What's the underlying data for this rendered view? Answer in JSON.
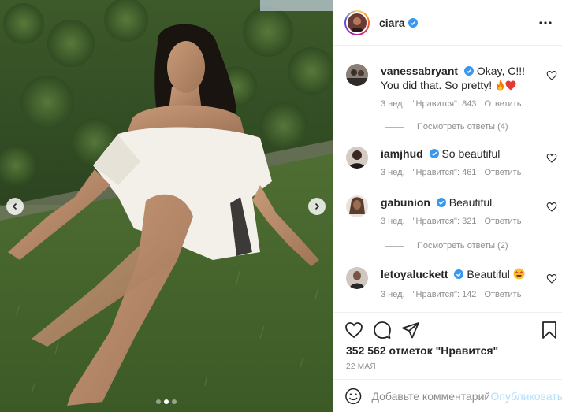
{
  "post": {
    "author": "ciara",
    "author_verified": true,
    "more_icon": "more-horizontal-icon",
    "carousel": {
      "current_slide": 2,
      "total_slides": 3
    }
  },
  "comments": [
    {
      "user": "vanessabryant",
      "verified": true,
      "text": "Okay, C!!! You did that. So pretty!",
      "emoji": [
        "fire",
        "red-heart"
      ],
      "time": "3 нед.",
      "likes": "\"Нравится\": 843",
      "reply": "Ответить",
      "view_replies": "Посмотреть ответы (4)"
    },
    {
      "user": "iamjhud",
      "verified": true,
      "text": "So beautiful",
      "emoji": [],
      "time": "3 нед.",
      "likes": "\"Нравится\": 461",
      "reply": "Ответить"
    },
    {
      "user": "gabunion",
      "verified": true,
      "text": "Beautiful",
      "emoji": [],
      "time": "3 нед.",
      "likes": "\"Нравится\": 321",
      "reply": "Ответить",
      "view_replies": "Посмотреть ответы (2)"
    },
    {
      "user": "letoyaluckett",
      "verified": true,
      "text": "Beautiful",
      "emoji": [
        "star-struck"
      ],
      "time": "3 нед.",
      "likes": "\"Нравится\": 142",
      "reply": "Ответить"
    }
  ],
  "actions": {
    "icons": [
      "heart-icon",
      "comment-icon",
      "share-icon",
      "bookmark-icon"
    ],
    "likes_count": "352 562 отметок \"Нравится\"",
    "date": "22 МАЯ"
  },
  "add_comment": {
    "placeholder": "Добавьте комментарий...",
    "publish": "Опубликовать"
  },
  "colors": {
    "verified": "#3897f0",
    "text": "#262626",
    "muted": "#8e8e8e",
    "publish_disabled": "#b2dffc",
    "border": "#efefef"
  }
}
